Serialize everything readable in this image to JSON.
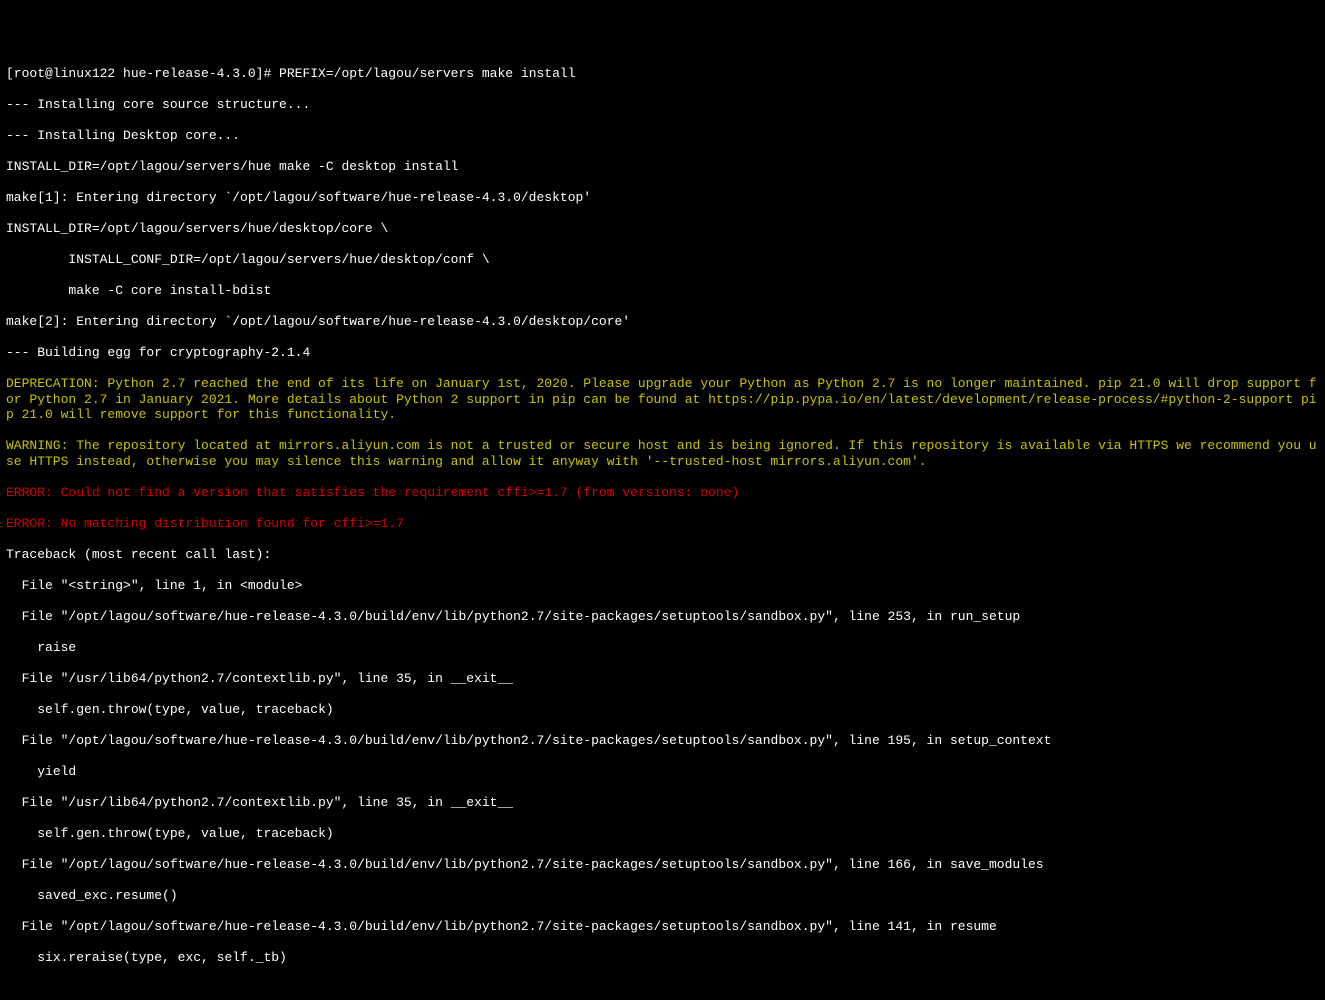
{
  "prompt": {
    "user_host": "[root@linux122 hue-release-4.3.0]# ",
    "command": "PREFIX=/opt/lagou/servers make install"
  },
  "lines": {
    "l1": "--- Installing core source structure...",
    "l2": "--- Installing Desktop core...",
    "l3": "INSTALL_DIR=/opt/lagou/servers/hue make -C desktop install",
    "l4": "make[1]: Entering directory `/opt/lagou/software/hue-release-4.3.0/desktop'",
    "l5": "INSTALL_DIR=/opt/lagou/servers/hue/desktop/core \\",
    "l6": "        INSTALL_CONF_DIR=/opt/lagou/servers/hue/desktop/conf \\",
    "l7": "        make -C core install-bdist",
    "l8": "make[2]: Entering directory `/opt/lagou/software/hue-release-4.3.0/desktop/core'",
    "l9": "--- Building egg for cryptography-2.1.4",
    "dep": "DEPRECATION: Python 2.7 reached the end of its life on January 1st, 2020. Please upgrade your Python as Python 2.7 is no longer maintained. pip 21.0 will drop support for Python 2.7 in January 2021. More details about Python 2 support in pip can be found at https://pip.pypa.io/en/latest/development/release-process/#python-2-support pip 21.0 will remove support for this functionality.",
    "warn": "WARNING: The repository located at mirrors.aliyun.com is not a trusted or secure host and is being ignored. If this repository is available via HTTPS we recommend you use HTTPS instead, otherwise you may silence this warning and allow it anyway with '--trusted-host mirrors.aliyun.com'.",
    "err1": "ERROR: Could not find a version that satisfies the requirement cffi>=1.7 (from versions: none)",
    "err2": "ERROR: No matching distribution found for cffi>=1.7",
    "tb0": "Traceback (most recent call last):",
    "tb1": "  File \"<string>\", line 1, in <module>",
    "tb2": "  File \"/opt/lagou/software/hue-release-4.3.0/build/env/lib/python2.7/site-packages/setuptools/sandbox.py\", line 253, in run_setup",
    "tb3": "    raise",
    "tb4": "  File \"/usr/lib64/python2.7/contextlib.py\", line 35, in __exit__",
    "tb5": "    self.gen.throw(type, value, traceback)",
    "tb6": "  File \"/opt/lagou/software/hue-release-4.3.0/build/env/lib/python2.7/site-packages/setuptools/sandbox.py\", line 195, in setup_context",
    "tb7": "    yield",
    "tb8": "  File \"/usr/lib64/python2.7/contextlib.py\", line 35, in __exit__",
    "tb9": "    self.gen.throw(type, value, traceback)",
    "tb10": "  File \"/opt/lagou/software/hue-release-4.3.0/build/env/lib/python2.7/site-packages/setuptools/sandbox.py\", line 166, in save_modules",
    "tb11": "    saved_exc.resume()",
    "tb12": "  File \"/opt/lagou/software/hue-release-4.3.0/build/env/lib/python2.7/site-packages/setuptools/sandbox.py\", line 141, in resume",
    "tb13": "    six.reraise(type, exc, self._tb)"
  }
}
